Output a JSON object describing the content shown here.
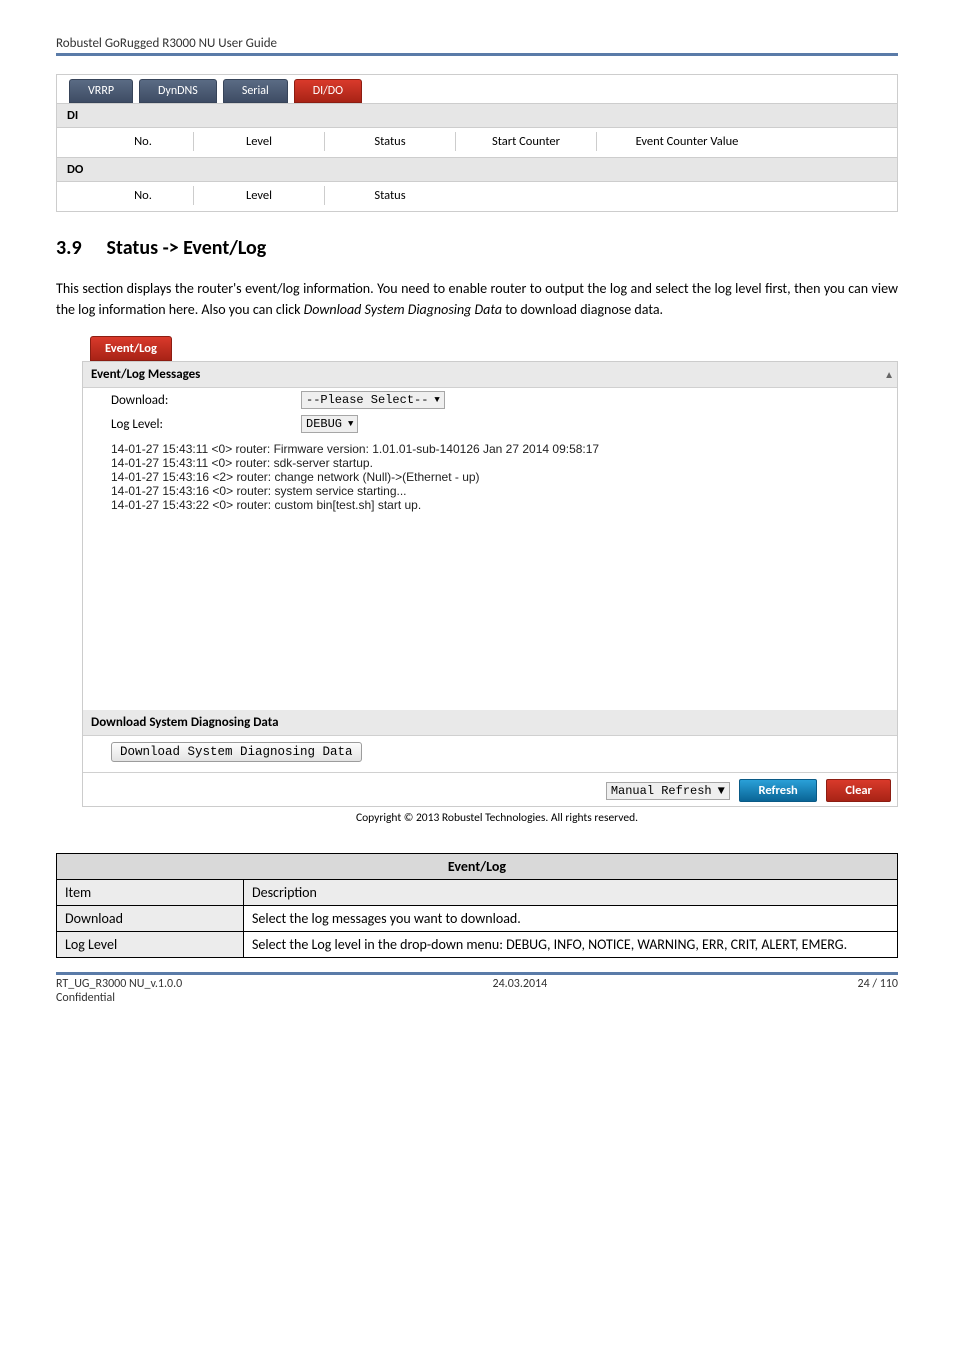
{
  "header": {
    "title": "Robustel GoRugged R3000 NU User Guide"
  },
  "tabs": [
    {
      "label": "VRRP",
      "active": false
    },
    {
      "label": "DynDNS",
      "active": false
    },
    {
      "label": "Serial",
      "active": false
    },
    {
      "label": "DI/DO",
      "active": true
    }
  ],
  "di_section": {
    "title": "DI",
    "cols": [
      "No.",
      "Level",
      "Status",
      "Start Counter",
      "Event Counter Value"
    ]
  },
  "do_section": {
    "title": "DO",
    "cols": [
      "No.",
      "Level",
      "Status"
    ]
  },
  "section": {
    "number": "3.9",
    "title": "Status -> Event/Log",
    "paragraph_pre": "This section displays the router's event/log information. You need to enable router to output the log and select the log level first, then you can view the log information here. Also you can click ",
    "paragraph_ital": "Download System Diagnosing Data",
    "paragraph_post": " to download diagnose data."
  },
  "eventlog": {
    "tab_label": "Event/Log",
    "messages_title": "Event/Log Messages",
    "download_label": "Download:",
    "download_select": "--Please Select--",
    "loglevel_label": "Log Level:",
    "loglevel_select": "DEBUG",
    "log_lines": "14-01-27 15:43:11 <0> router: Firmware version: 1.01.01-sub-140126 Jan 27 2014 09:58:17\n14-01-27 15:43:11 <0> router: sdk-server startup.\n14-01-27 15:43:16 <2> router: change network (Null)->(Ethernet - up)\n14-01-27 15:43:16 <0> router: system service starting...\n14-01-27 15:43:22 <0> router: custom bin[test.sh] start up.",
    "diag_title": "Download System Diagnosing Data",
    "diag_button": "Download System Diagnosing Data",
    "refresh_mode": "Manual Refresh",
    "refresh_btn": "Refresh",
    "clear_btn": "Clear",
    "copyright": "Copyright © 2013 Robustel Technologies. All rights reserved."
  },
  "desc_table": {
    "title": "Event/Log",
    "header_item": "Item",
    "header_desc": "Description",
    "rows": [
      {
        "item": "Download",
        "desc": "Select the log messages you want to download."
      },
      {
        "item": "Log Level",
        "desc": "Select the Log level in the drop-down menu: DEBUG, INFO, NOTICE, WARNING, ERR, CRIT, ALERT, EMERG."
      }
    ]
  },
  "footer": {
    "left1": "RT_UG_R3000 NU_v.1.0.0",
    "left2": "Confidential",
    "center": "24.03.2014",
    "right": "24 / 110"
  }
}
